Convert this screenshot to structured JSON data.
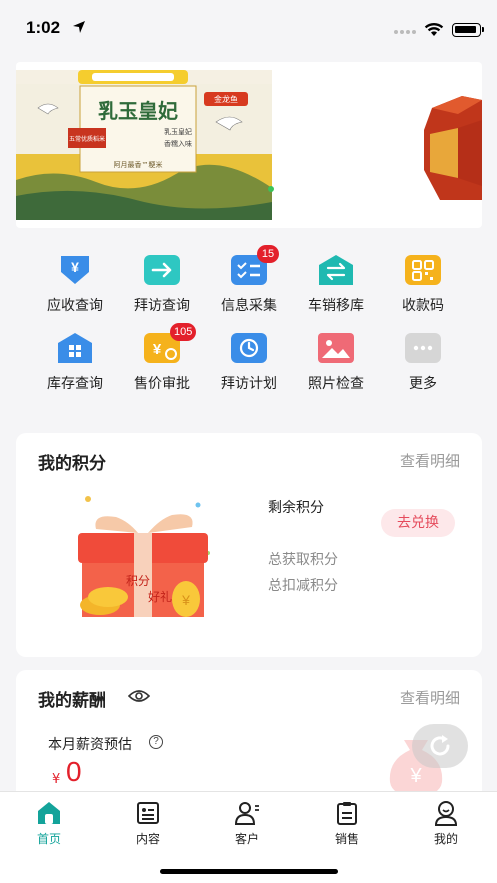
{
  "status_bar": {
    "time": "1:02"
  },
  "banner": {
    "product_name": "乳玉皇妃",
    "brand_tag": "金龙鱼",
    "slogan_1": "乳玉皇妃",
    "slogan_2": "香糯入味",
    "origin_tag": "五常优质稻米",
    "sub_line": "优质稻米",
    "footer": "阿月最香™粳米"
  },
  "quick_actions": [
    {
      "label": "应收查询",
      "icon": "yuan-down-icon",
      "color": "#3a8de8"
    },
    {
      "label": "拜访查询",
      "icon": "arrow-right-icon",
      "color": "#2ec7c2"
    },
    {
      "label": "信息采集",
      "icon": "checklist-icon",
      "color": "#3a8de8",
      "badge": "15"
    },
    {
      "label": "车销移库",
      "icon": "transfer-icon",
      "color": "#1fb9b1"
    },
    {
      "label": "收款码",
      "icon": "qrcode-icon",
      "color": "#f5b21c"
    },
    {
      "label": "库存查询",
      "icon": "inventory-icon",
      "color": "#3a8de8"
    },
    {
      "label": "售价审批",
      "icon": "price-approval-icon",
      "color": "#f5b21c",
      "badge": "105"
    },
    {
      "label": "拜访计划",
      "icon": "visit-plan-icon",
      "color": "#3a8de8"
    },
    {
      "label": "照片检查",
      "icon": "photo-icon",
      "color": "#ef6a76"
    },
    {
      "label": "更多",
      "icon": "more-icon",
      "color": "#cfcfcf"
    }
  ],
  "points": {
    "title": "我的积分",
    "detail_link": "查看明细",
    "remaining_label": "剩余积分",
    "exchange_button": "去兑换",
    "total_label": "总获取积分",
    "deduct_label": "总扣减积分",
    "gift_text_1": "积分",
    "gift_text_2": "好礼"
  },
  "salary": {
    "title": "我的薪酬",
    "detail_link": "查看明细",
    "estimate_label": "本月薪资预估",
    "currency": "¥",
    "value": "0"
  },
  "tabbar": [
    {
      "label": "首页",
      "icon": "home-icon",
      "active": true
    },
    {
      "label": "内容",
      "icon": "content-icon",
      "active": false
    },
    {
      "label": "客户",
      "icon": "customer-icon",
      "active": false
    },
    {
      "label": "销售",
      "icon": "sales-icon",
      "active": false
    },
    {
      "label": "我的",
      "icon": "profile-icon",
      "active": false
    }
  ],
  "colors": {
    "accent": "#13a39a",
    "badge": "#e3202b",
    "danger": "#e3202b"
  }
}
